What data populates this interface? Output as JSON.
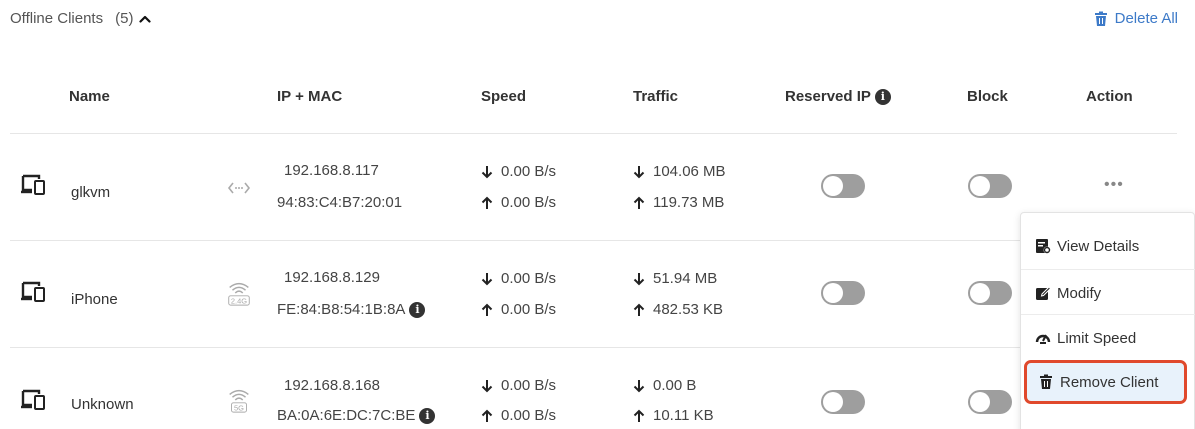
{
  "header": {
    "title": "Offline Clients",
    "count": "(5)",
    "delete_all": "Delete All"
  },
  "columns": {
    "name": "Name",
    "ip_mac": "IP + MAC",
    "speed": "Speed",
    "traffic": "Traffic",
    "reserved_ip": "Reserved IP",
    "block": "Block",
    "action": "Action"
  },
  "clients": [
    {
      "name": "glkvm",
      "connection": "ethernet-icon",
      "badge": "",
      "ip": "192.168.8.117",
      "mac": "94:83:C4:B7:20:01",
      "mac_info": false,
      "down_speed": "0.00 B/s",
      "up_speed": "0.00 B/s",
      "down_traffic": "104.06 MB",
      "up_traffic": "119.73 MB",
      "reserved_ip": false,
      "blocked": false
    },
    {
      "name": "iPhone",
      "connection": "wifi-icon",
      "badge": "2.4G",
      "ip": "192.168.8.129",
      "mac": "FE:84:B8:54:1B:8A",
      "mac_info": true,
      "down_speed": "0.00 B/s",
      "up_speed": "0.00 B/s",
      "down_traffic": "51.94 MB",
      "up_traffic": "482.53 KB",
      "reserved_ip": false,
      "blocked": false
    },
    {
      "name": "Unknown",
      "connection": "wifi-icon",
      "badge": "5G",
      "ip": "192.168.8.168",
      "mac": "BA:0A:6E:DC:7C:BE",
      "mac_info": true,
      "down_speed": "0.00 B/s",
      "up_speed": "0.00 B/s",
      "down_traffic": "0.00 B",
      "up_traffic": "10.11 KB",
      "reserved_ip": false,
      "blocked": false
    }
  ],
  "action_menu": {
    "more": "•••",
    "view_details": "View Details",
    "modify": "Modify",
    "limit_speed": "Limit Speed",
    "remove_client": "Remove Client"
  },
  "colors": {
    "accent": "#3d7ac8",
    "toggle_off": "#9e9e9e",
    "highlight_border": "#e0492c",
    "highlight_bg": "#e8f2fb"
  }
}
